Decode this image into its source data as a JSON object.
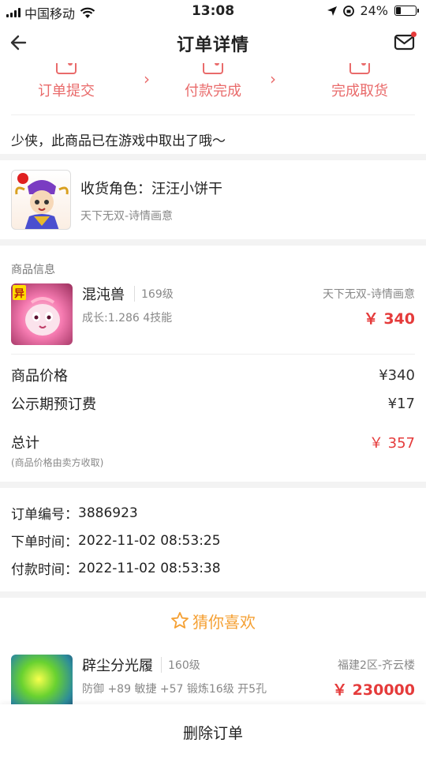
{
  "status_bar": {
    "carrier": "中国移动",
    "time": "13:08",
    "battery": "24%",
    "battery_level": 0.24
  },
  "nav": {
    "title": "订单详情"
  },
  "steps": [
    {
      "label": "订单提交"
    },
    {
      "label": "付款完成"
    },
    {
      "label": "完成取货"
    }
  ],
  "notice": "少侠，此商品已在游戏中取出了哦～",
  "role": {
    "title": "收货角色：汪汪小饼干",
    "server": "天下无双-诗情画意"
  },
  "goods": {
    "section_label": "商品信息",
    "name": "混沌兽",
    "level": "169级",
    "server": "天下无双-诗情画意",
    "stats": "成长:1.286 4技能",
    "price": "￥ 340",
    "badge": "异"
  },
  "fees": {
    "items": [
      {
        "label": "商品价格",
        "value": "¥340"
      },
      {
        "label": "公示期预订费",
        "value": "¥17"
      }
    ],
    "total_label": "总计",
    "total_value": "￥ 357",
    "total_note": "(商品价格由卖方收取)"
  },
  "order_info": {
    "rows": [
      {
        "label": "订单编号：",
        "value": "3886923"
      },
      {
        "label": "下单时间：",
        "value": "2022-11-02 08:53:25"
      },
      {
        "label": "付款时间：",
        "value": "2022-11-02 08:53:38"
      }
    ]
  },
  "guess": {
    "title": "猜你喜欢",
    "item": {
      "name": "辟尘分光履",
      "level": "160级",
      "server": "福建2区-齐云楼",
      "stats": "防御 +89 敏捷 +57 锻炼16级 开5孔",
      "price": "￥ 230000"
    }
  },
  "bottom": {
    "delete_label": "删除订单"
  },
  "colors": {
    "accent_red": "#e53b3b",
    "step_red": "#e96b6b",
    "guess_orange": "#f5a033"
  }
}
